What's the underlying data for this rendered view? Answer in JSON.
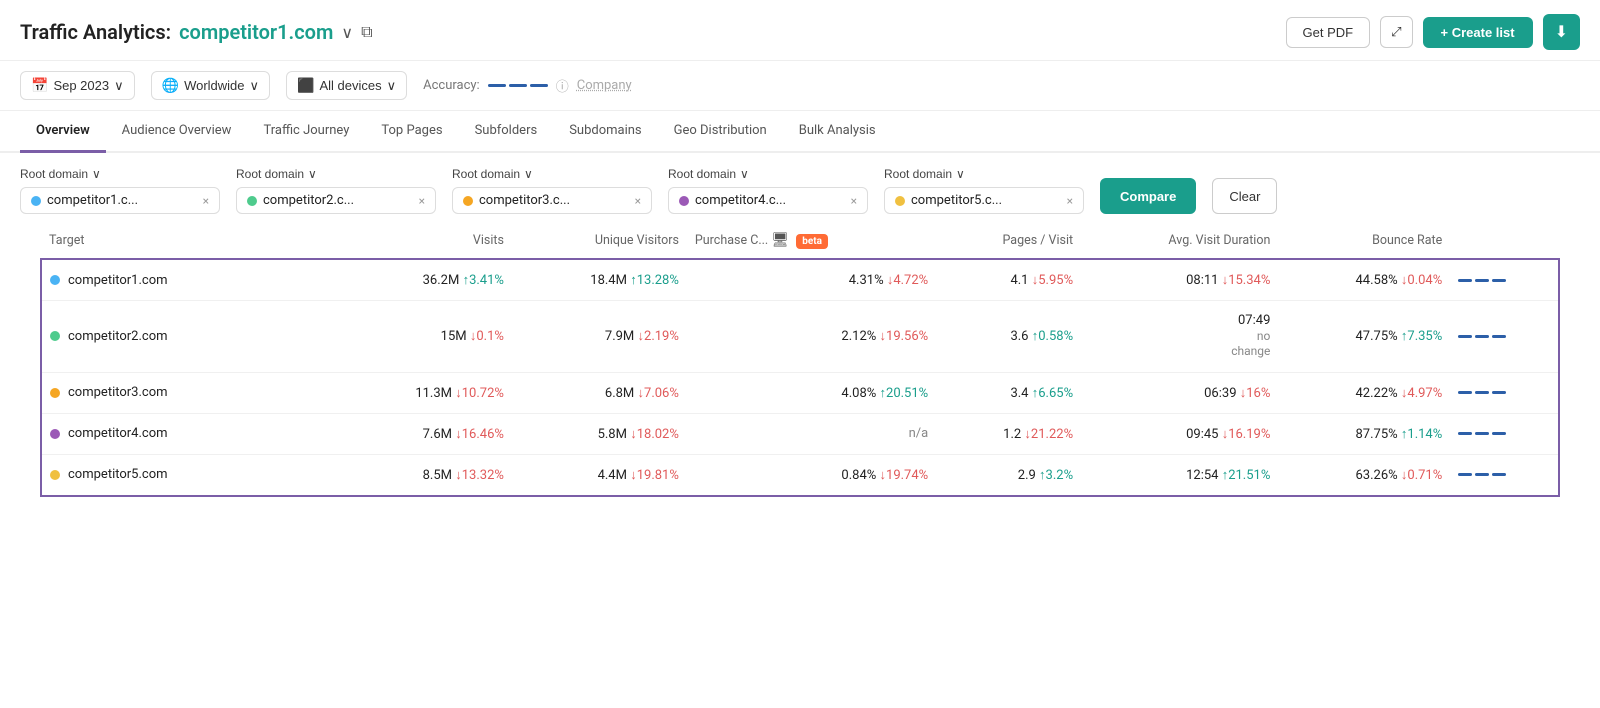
{
  "header": {
    "title_prefix": "Traffic Analytics:",
    "title_domain": "competitor1.com",
    "get_pdf_label": "Get PDF",
    "expand_icon": "⤢",
    "create_list_label": "+ Create list",
    "download_icon": "⬇"
  },
  "filters": {
    "date": "Sep 2023",
    "geo": "Worldwide",
    "device": "All devices",
    "accuracy_label": "Accuracy:",
    "company_label": "Company"
  },
  "nav_tabs": [
    {
      "label": "Overview",
      "active": true
    },
    {
      "label": "Audience Overview",
      "active": false
    },
    {
      "label": "Traffic Journey",
      "active": false
    },
    {
      "label": "Top Pages",
      "active": false
    },
    {
      "label": "Subfolders",
      "active": false
    },
    {
      "label": "Subdomains",
      "active": false
    },
    {
      "label": "Geo Distribution",
      "active": false
    },
    {
      "label": "Bulk Analysis",
      "active": false
    }
  ],
  "domain_selectors": {
    "root_domain_label": "Root domain",
    "domains": [
      {
        "color": "#4ab3f4",
        "name": "competitor1.c...",
        "close": "×"
      },
      {
        "color": "#4ecb8d",
        "name": "competitor2.c...",
        "close": "×"
      },
      {
        "color": "#f5a623",
        "name": "competitor3.c...",
        "close": "×"
      },
      {
        "color": "#9b59b6",
        "name": "competitor4.c...",
        "close": "×"
      },
      {
        "color": "#f0c040",
        "name": "competitor5.c...",
        "close": "×"
      }
    ],
    "compare_label": "Compare",
    "clear_label": "Clear"
  },
  "table": {
    "columns": [
      "Target",
      "Visits",
      "Unique Visitors",
      "Purchase C...",
      "Pages / Visit",
      "Avg. Visit Duration",
      "Bounce Rate"
    ],
    "rows": [
      {
        "color": "#4ab3f4",
        "domain": "competitor1.com",
        "visits": "36.2M",
        "visits_change": "↑3.41%",
        "visits_change_dir": "up",
        "unique": "18.4M",
        "unique_change": "↑13.28%",
        "unique_change_dir": "up",
        "purchase": "4.31%",
        "purchase_change": "↓4.72%",
        "purchase_change_dir": "down",
        "pages": "4.1",
        "pages_change": "↓5.95%",
        "pages_change_dir": "down",
        "duration": "08:11",
        "duration_change": "↓15.34%",
        "duration_change_dir": "down",
        "bounce": "44.58%",
        "bounce_change": "↓0.04%",
        "bounce_change_dir": "down"
      },
      {
        "color": "#4ecb8d",
        "domain": "competitor2.com",
        "visits": "15M",
        "visits_change": "↓0.1%",
        "visits_change_dir": "down",
        "unique": "7.9M",
        "unique_change": "↓2.19%",
        "unique_change_dir": "down",
        "purchase": "2.12%",
        "purchase_change": "↓19.56%",
        "purchase_change_dir": "down",
        "pages": "3.6",
        "pages_change": "↑0.58%",
        "pages_change_dir": "up",
        "duration": "07:49",
        "duration_change": "no change",
        "duration_change_dir": "neutral",
        "bounce": "47.75%",
        "bounce_change": "↑7.35%",
        "bounce_change_dir": "up"
      },
      {
        "color": "#f5a623",
        "domain": "competitor3.com",
        "visits": "11.3M",
        "visits_change": "↓10.72%",
        "visits_change_dir": "down",
        "unique": "6.8M",
        "unique_change": "↓7.06%",
        "unique_change_dir": "down",
        "purchase": "4.08%",
        "purchase_change": "↑20.51%",
        "purchase_change_dir": "up",
        "pages": "3.4",
        "pages_change": "↑6.65%",
        "pages_change_dir": "up",
        "duration": "06:39",
        "duration_change": "↓16%",
        "duration_change_dir": "down",
        "bounce": "42.22%",
        "bounce_change": "↓4.97%",
        "bounce_change_dir": "down"
      },
      {
        "color": "#9b59b6",
        "domain": "competitor4.com",
        "visits": "7.6M",
        "visits_change": "↓16.46%",
        "visits_change_dir": "down",
        "unique": "5.8M",
        "unique_change": "↓18.02%",
        "unique_change_dir": "down",
        "purchase": "n/a",
        "purchase_change": "",
        "purchase_change_dir": "neutral",
        "pages": "1.2",
        "pages_change": "↓21.22%",
        "pages_change_dir": "down",
        "duration": "09:45",
        "duration_change": "↓16.19%",
        "duration_change_dir": "down",
        "bounce": "87.75%",
        "bounce_change": "↑1.14%",
        "bounce_change_dir": "up"
      },
      {
        "color": "#f0c040",
        "domain": "competitor5.com",
        "visits": "8.5M",
        "visits_change": "↓13.32%",
        "visits_change_dir": "down",
        "unique": "4.4M",
        "unique_change": "↓19.81%",
        "unique_change_dir": "down",
        "purchase": "0.84%",
        "purchase_change": "↓19.74%",
        "purchase_change_dir": "down",
        "pages": "2.9",
        "pages_change": "↑3.2%",
        "pages_change_dir": "up",
        "duration": "12:54",
        "duration_change": "↑21.51%",
        "duration_change_dir": "up",
        "bounce": "63.26%",
        "bounce_change": "↓0.71%",
        "bounce_change_dir": "down"
      }
    ]
  }
}
